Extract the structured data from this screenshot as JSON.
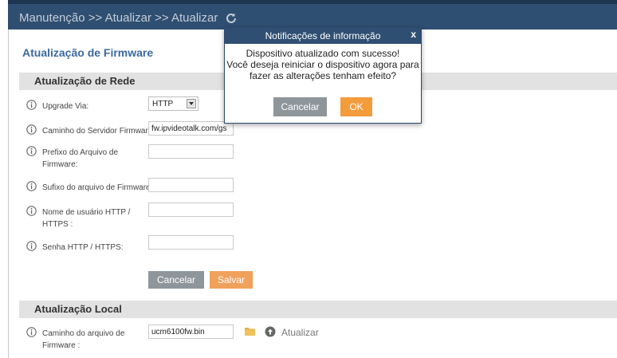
{
  "breadcrumb": {
    "text": "Manutenção >> Atualizar >> Atualizar"
  },
  "page": {
    "title": "Atualização de Firmware"
  },
  "network_section": {
    "title": "Atualização de Rede",
    "upgrade_via": {
      "label": "Upgrade Via:",
      "value": "HTTP"
    },
    "server_path": {
      "label": "Caminho do Servidor Firmware:",
      "value": "fw.ipvideotalk.com/gs"
    },
    "file_prefix": {
      "label": "Prefixo do Arquivo de Firmware:",
      "value": ""
    },
    "file_suffix": {
      "label": "Sufixo do arquivo de Firmware:",
      "value": ""
    },
    "http_user": {
      "label": "Nome de usuário HTTP / HTTPS :",
      "value": ""
    },
    "http_password": {
      "label": "Senha HTTP / HTTPS:",
      "value": ""
    },
    "cancel_label": "Cancelar",
    "save_label": "Salvar"
  },
  "local_section": {
    "title": "Atualização Local",
    "file_path": {
      "label": "Caminho do arquivo de Firmware :",
      "value": "ucm6100fw.bin"
    },
    "upload_label": "Atualizar"
  },
  "dialog": {
    "title": "Notificações de informação",
    "close": "x",
    "message_line1": "Dispositivo atualizado com sucesso!",
    "message_line2": "Você deseja reiniciar o dispositivo agora para",
    "message_line3": "fazer as alterações tenham efeito?",
    "cancel_label": "Cancelar",
    "ok_label": "OK"
  },
  "colors": {
    "header_bg": "#2f4f72",
    "accent_blue": "#3b6aa0",
    "orange": "#f0a15c",
    "grey_button": "#8e969c",
    "section_bg": "#e2e2e2"
  },
  "icons": [
    "refresh-icon",
    "info-icon",
    "dropdown-arrow-icon",
    "folder-icon",
    "upload-icon",
    "close-icon"
  ]
}
